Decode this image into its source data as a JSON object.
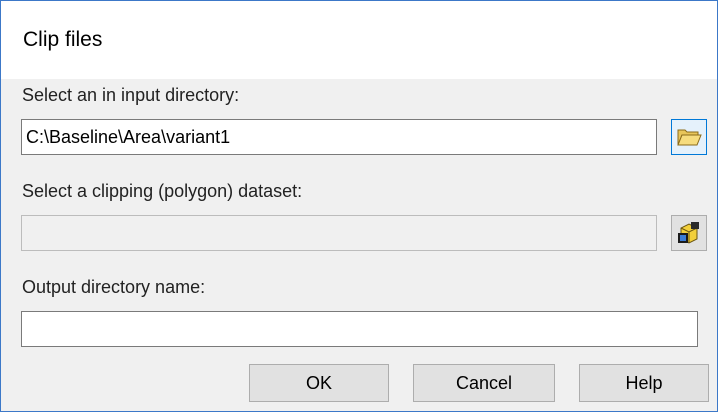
{
  "window": {
    "title": "Clip files"
  },
  "input_directory": {
    "label": "Select an in input directory:",
    "value": "C:\\Baseline\\Area\\variant1",
    "browse_icon": "folder-open-icon"
  },
  "clipping_dataset": {
    "label": "Select a clipping (polygon) dataset:",
    "value": "",
    "browse_icon": "add-data-icon"
  },
  "output_directory": {
    "label": "Output directory name:",
    "value": ""
  },
  "buttons": {
    "ok": "OK",
    "cancel": "Cancel",
    "help": "Help"
  },
  "colors": {
    "window_border": "#3c78c8",
    "dialog_background": "#f0f0f0",
    "focus_accent": "#0078d7"
  }
}
